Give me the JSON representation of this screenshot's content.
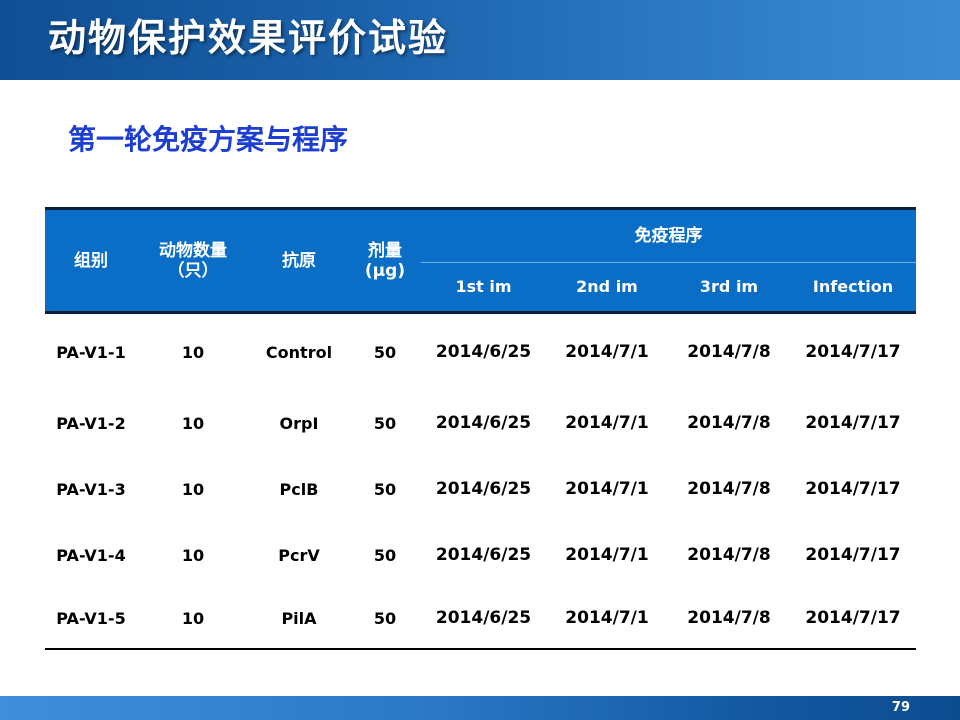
{
  "slide": {
    "title": "动物保护效果评价试验",
    "subtitle": "第一轮免疫方案与程序",
    "page_number": "79"
  },
  "table": {
    "headers": {
      "group": "组别",
      "animal_count": "动物数量\n（只）",
      "antigen": "抗原",
      "dose": "剂量\n(μg)",
      "schedule": "免疫程序",
      "schedule_cols": [
        "1st im",
        "2nd im",
        "3rd im",
        "Infection"
      ]
    },
    "rows": [
      {
        "group": "PA-V1-1",
        "count": "10",
        "antigen": "Control",
        "dose": "50",
        "d1": "2014/6/25",
        "d2": "2014/7/1",
        "d3": "2014/7/8",
        "d4": "2014/7/17"
      },
      {
        "group": "PA-V1-2",
        "count": "10",
        "antigen": "OrpI",
        "dose": "50",
        "d1": "2014/6/25",
        "d2": "2014/7/1",
        "d3": "2014/7/8",
        "d4": "2014/7/17"
      },
      {
        "group": "PA-V1-3",
        "count": "10",
        "antigen": "PclB",
        "dose": "50",
        "d1": "2014/6/25",
        "d2": "2014/7/1",
        "d3": "2014/7/8",
        "d4": "2014/7/17"
      },
      {
        "group": "PA-V1-4",
        "count": "10",
        "antigen": "PcrV",
        "dose": "50",
        "d1": "2014/6/25",
        "d2": "2014/7/1",
        "d3": "2014/7/8",
        "d4": "2014/7/17"
      },
      {
        "group": "PA-V1-5",
        "count": "10",
        "antigen": "PilA",
        "dose": "50",
        "d1": "2014/6/25",
        "d2": "2014/7/1",
        "d3": "2014/7/8",
        "d4": "2014/7/17"
      }
    ]
  },
  "colors": {
    "title_bar": "#1c63ad",
    "subtitle": "#1c3fd1",
    "table_header": "#0a6ec7"
  }
}
